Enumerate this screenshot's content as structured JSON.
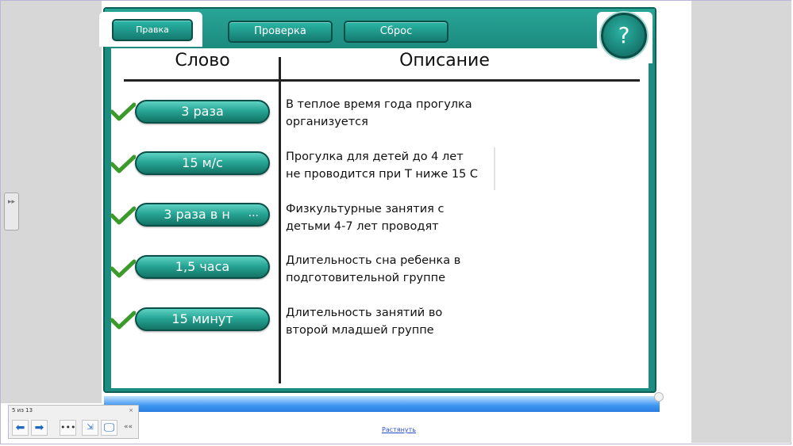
{
  "toolbar": {
    "edit_label": "Правка",
    "check_label": "Проверка",
    "reset_label": "Сброс",
    "help_label": "?"
  },
  "table": {
    "col_word": "Слово",
    "col_desc": "Описание",
    "rows": [
      {
        "word": "3 раза",
        "desc_line1": "В теплое время года прогулка",
        "desc_line2": "организуется"
      },
      {
        "word": "15 м/с",
        "desc_line1": "Прогулка для детей до 4 лет",
        "desc_line2": "не проводится при Т ниже 15 С"
      },
      {
        "word": "3 раза в н",
        "word_more": "...",
        "desc_line1": "Физкультурные занятия с",
        "desc_line2": "детьми 4-7 лет проводят"
      },
      {
        "word": "1,5 часа",
        "desc_line1": "Длительность сна ребенка в",
        "desc_line2": "подготовительной группе"
      },
      {
        "word": "15 минут",
        "desc_line1": "Длительность занятий во",
        "desc_line2": "второй младшей группе"
      }
    ]
  },
  "nav": {
    "slide_counter": "5 из 13",
    "close": "×",
    "collapse": "««"
  },
  "footer": {
    "expand_link": "Растянуть"
  },
  "colors": {
    "teal": "#1d8c80",
    "teal_dark": "#0e5f56",
    "check_green": "#3a9a2a",
    "blue_bar": "#3d95f2"
  }
}
